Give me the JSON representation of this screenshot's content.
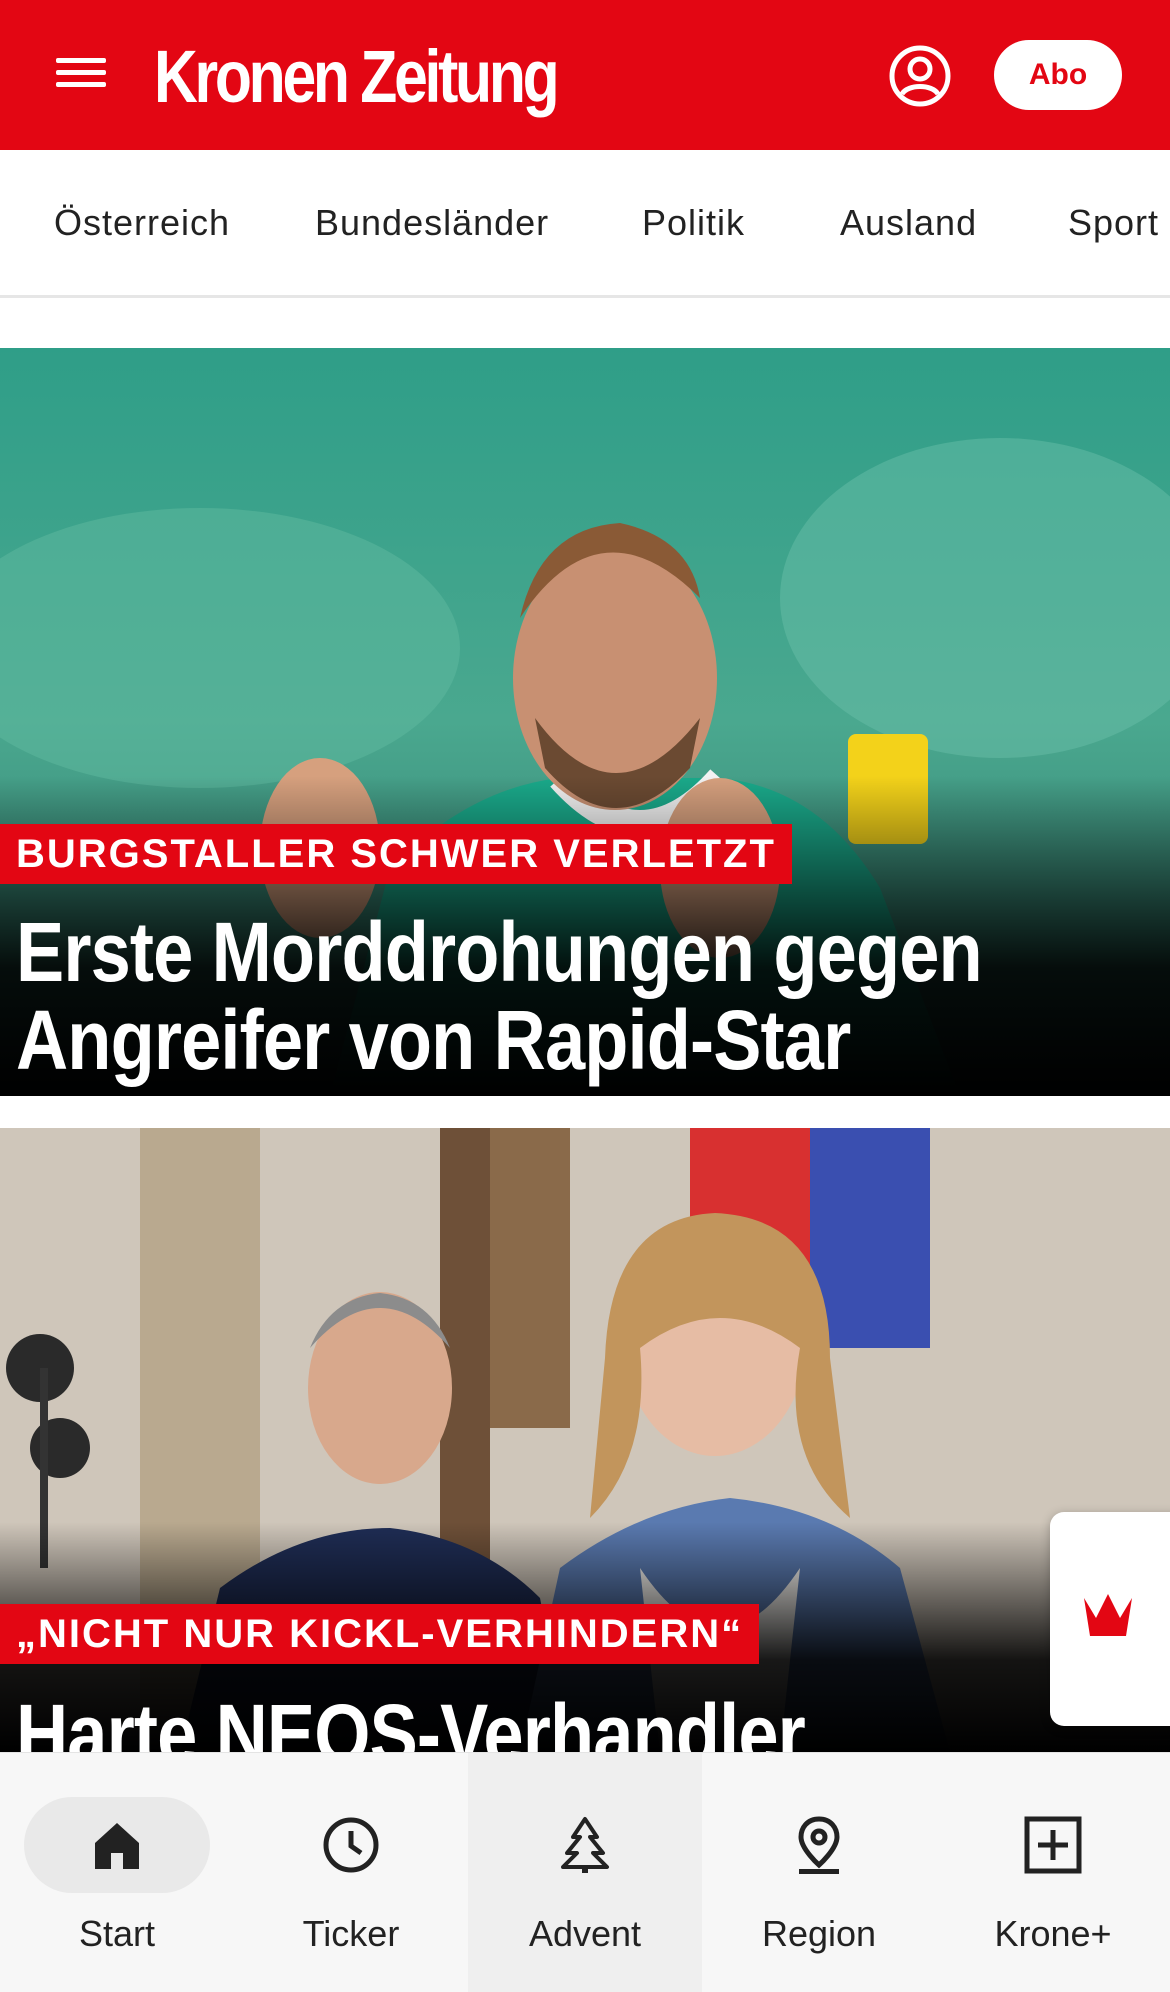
{
  "header": {
    "logo_text": "Kronen Zeitung",
    "abo_label": "Abo",
    "brand_color": "#e30613",
    "menu_icon": "hamburger-menu-icon",
    "account_icon": "user-account-icon"
  },
  "nav": {
    "items": [
      "Österreich",
      "Bundesländer",
      "Politik",
      "Ausland",
      "Sport"
    ]
  },
  "articles": [
    {
      "kicker": "BURGSTALLER SCHWER VERLETZT",
      "headline_line1": "Erste Morddrohungen gegen",
      "headline_line2": "Angreifer von Rapid-Star"
    },
    {
      "kicker": "„NICHT NUR KICKL-VERHINDERN“",
      "headline_line1": "Harte NEOS-Verhandler"
    }
  ],
  "floating_button": {
    "icon": "krone-crown-icon"
  },
  "bottom_nav": {
    "tabs": [
      {
        "label": "Start",
        "icon": "home-icon"
      },
      {
        "label": "Ticker",
        "icon": "clock-icon"
      },
      {
        "label": "Advent",
        "icon": "christmas-tree-icon"
      },
      {
        "label": "Region",
        "icon": "location-pin-icon"
      },
      {
        "label": "Krone+",
        "icon": "plus-square-icon"
      }
    ]
  }
}
